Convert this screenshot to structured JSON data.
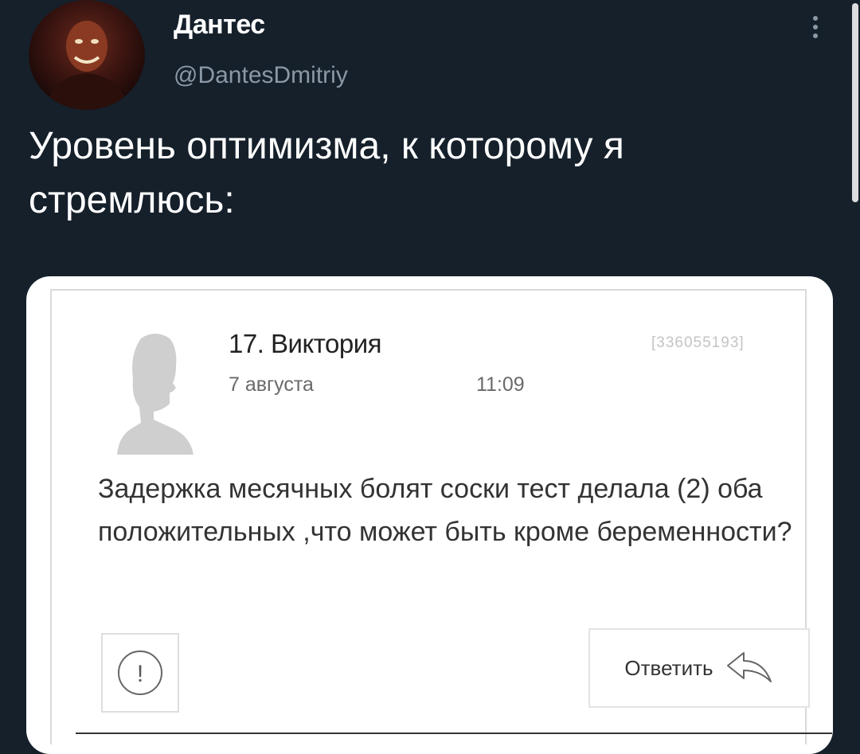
{
  "user": {
    "display_name": "Дантес",
    "handle": "@DantesDmitriy"
  },
  "tweet": {
    "text": "Уровень оптимизма, к которому я стремлюсь:"
  },
  "media": {
    "comment": {
      "name": "17. Виктория",
      "date": "7 августа",
      "time": "11:09",
      "id": "[336055193]",
      "body": "Задержка месячных болят соски тест делала (2) оба положительных ,что может быть кроме беременности?",
      "reply_label": "Ответить",
      "report_symbol": "!"
    }
  },
  "icons": {
    "more": "more-vertical-icon",
    "report": "exclamation-circle-icon",
    "reply": "reply-arrow-icon",
    "avatar_placeholder": "person-silhouette-icon"
  },
  "colors": {
    "background": "#15202b",
    "text_primary": "#ffffff",
    "text_secondary": "#8b98a5",
    "media_background": "#ffffff"
  }
}
